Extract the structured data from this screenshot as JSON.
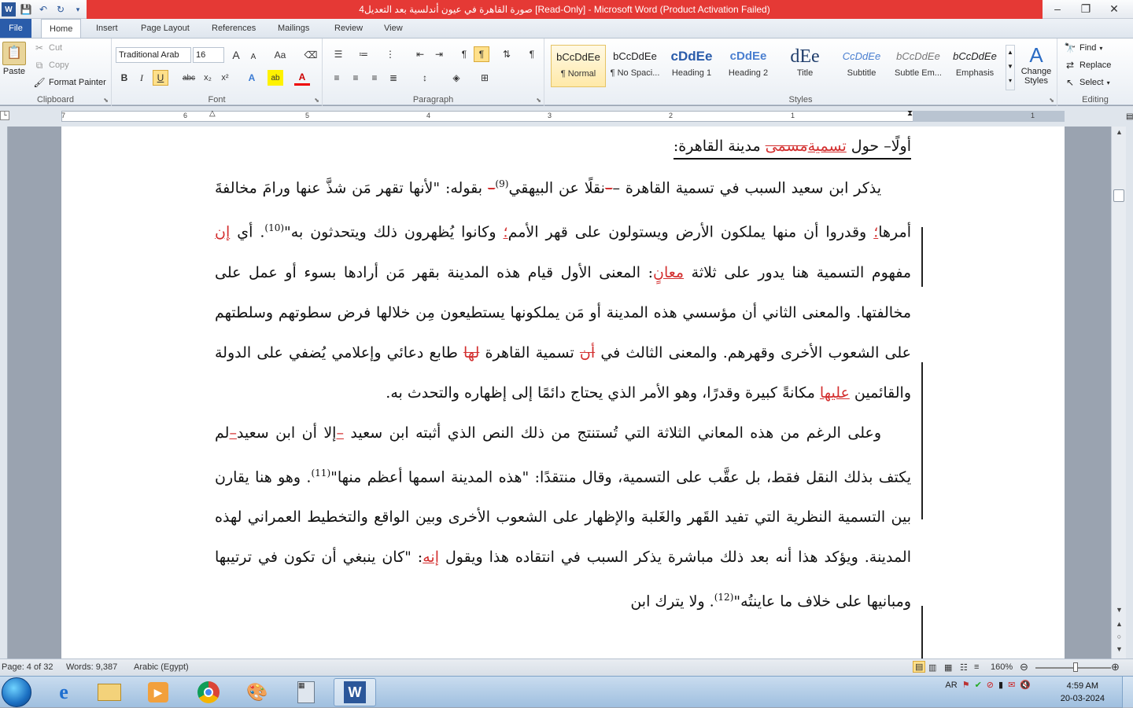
{
  "titlebar": {
    "title": "صورة القاهرة في عيون أندلسية بعد التعديل4 [Read-Only]  -  Microsoft Word (Product Activation Failed)",
    "minimize": "–",
    "restore": "❐",
    "close": "✕",
    "accent_color": "#e53935"
  },
  "tabs": [
    "File",
    "Home",
    "Insert",
    "Page Layout",
    "References",
    "Mailings",
    "Review",
    "View"
  ],
  "clipboard": {
    "paste": "Paste",
    "cut": "Cut",
    "copy": "Copy",
    "format_painter": "Format Painter",
    "label": "Clipboard"
  },
  "font": {
    "name": "Traditional Arab",
    "size": "16",
    "label": "Font",
    "bold": "B",
    "italic": "I",
    "underline": "U",
    "strike": "abc",
    "subscript": "x₂",
    "superscript": "x²",
    "grow": "A",
    "shrink": "A",
    "change_case": "Aa",
    "font_color_letter": "A"
  },
  "paragraph": {
    "label": "Paragraph"
  },
  "styles": {
    "label": "Styles",
    "items": [
      {
        "sample": "bCcDdEe",
        "name": "¶ Normal"
      },
      {
        "sample": "bCcDdEe",
        "name": "¶ No Spaci..."
      },
      {
        "sample": "cDdEe",
        "name": "Heading 1"
      },
      {
        "sample": "cDdEe",
        "name": "Heading 2"
      },
      {
        "sample": "dEe",
        "name": "Title"
      },
      {
        "sample": "CcDdEe",
        "name": "Subtitle"
      },
      {
        "sample": "bCcDdEe",
        "name": "Subtle Em..."
      },
      {
        "sample": "bCcDdEe",
        "name": "Emphasis"
      }
    ],
    "change_styles": "Change Styles"
  },
  "editing": {
    "label": "Editing",
    "find": "Find",
    "replace": "Replace",
    "select": "Select"
  },
  "ruler_numbers": [
    "7",
    "6",
    "5",
    "4",
    "3",
    "2",
    "1"
  ],
  "document": {
    "heading": {
      "pre": "أولًا– حول ",
      "ins": "تسمية",
      "del": "مسمى",
      "post": " مدينة القاهرة:"
    },
    "p1": {
      "a": "يذكر ابن سعيد السبب في تسمية القاهرة –",
      "b": "نقلًا عن البيهقي",
      "sup1": "(9)",
      "c": " بقوله: \"لأنها تقهر مَن شذَّ عنها ورامَ مخالفةَ أمرها",
      "d": " وقدروا أن منها يملكون الأرض ويستولون على قهر الأمم",
      "e": " وكانوا يُظهرون ذلك ويتحدثون به\"",
      "sup2": "(10)",
      "f": ". أي ",
      "g": "إن",
      "h": " مفهوم التسمية هنا يدور على ثلاثة ",
      "i": "معانٍ",
      "j": ": المعنى",
      "k": " الأول قيام هذه المدينة بقهر مَن أرادها بسوء أو عمل على مخالفتها. والمعنى الثاني أن مؤسسي هذه المدينة أو مَن يملكونها يستطيعون مِن خلالها فرض سطوتهم وسلطتهم على الشعوب الأخرى وقهرهم. والمعنى الثالث في ",
      "l": "أن",
      "m": " تسمية القاهرة ",
      "n": "لها",
      "o": " طابع دعائي وإعلامي يُضفي على الدولة والقائمين ",
      "p": "عليها",
      "q": " مكانةً كبيرة وقدرًا",
      "r": "، وهو الأمر الذي يحتاج دائمًا إلى إظهاره والتحدث به."
    },
    "p2": {
      "a": "وعلى الرغم من هذه المعاني الثلاثة التي تُستنتج من ذلك النص الذي أثبته ابن سعيد ",
      "b": "–",
      "c": "إلا أن ابن سعيد",
      "d": "–",
      "e": "لم يكتف بذلك النقل فقط",
      "f": "، بل عقَّب على التسمية، وقال منتقدًا: \"هذه المدينة اسمها أعظم منها\"",
      "sup": "(11)",
      "g": ". وهو هنا يقارن بين التسمية النظرية التي تفيد القَهر والغَلبة والإظهار على الشعوب الأخرى وبين الواقع والتخطيط العمراني لهذه المدينة. ويؤكد هذا أنه بعد ذلك مباشرة يذكر السبب في انتقاده هذا ويقول ",
      "h": "إنه",
      "i": ": \"كان ينبغي أن تكون في ترتيبها ومبانيها على خلاف ما عاينتُه\"",
      "sup2": "(12)",
      "j": ". ولا يترك ابن"
    }
  },
  "statusbar": {
    "page": "Page: 4 of 32",
    "words": "Words: 9,387",
    "language": "Arabic (Egypt)",
    "zoom": "160%"
  },
  "taskbar": {
    "lang": "AR",
    "time": "4:59 AM",
    "date": "20-03-2024"
  }
}
